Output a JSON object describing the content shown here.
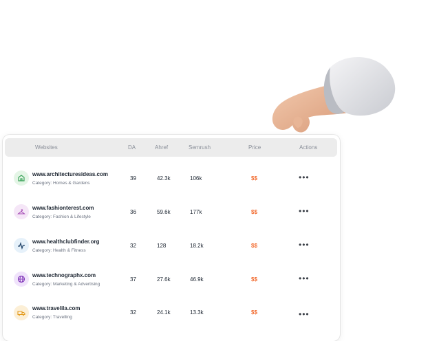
{
  "table": {
    "headers": {
      "websites": "Websites",
      "da": "DA",
      "ahref": "Ahref",
      "semrush": "Semrush",
      "price": "Price",
      "actions": "Actions"
    },
    "rows": [
      {
        "site": "www.architecturesideas.com",
        "category": "Category: Homes & Gardens",
        "da": "39",
        "ahref": "42.3k",
        "semrush": "106k",
        "price": "$$",
        "actions": "•••",
        "icon": "home-garden-icon",
        "icon_bg": "#e4f5e6",
        "icon_color": "#3aa35a"
      },
      {
        "site": "www.fashionterest.com",
        "category": "Category: Fashion & Lifestyle",
        "da": "36",
        "ahref": "59.6k",
        "semrush": "177k",
        "price": "$$",
        "actions": "•••",
        "icon": "hanger-icon",
        "icon_bg": "#f5e6f7",
        "icon_color": "#a34ab3"
      },
      {
        "site": "www.healthclubfinder.org",
        "category": "Category: Health & Fitness",
        "da": "32",
        "ahref": "128",
        "semrush": "18.2k",
        "price": "$$",
        "actions": "•••",
        "icon": "pulse-icon",
        "icon_bg": "#e6f1fa",
        "icon_color": "#23466b"
      },
      {
        "site": "www.technographx.com",
        "category": "Category: Marketing & Advertising",
        "da": "37",
        "ahref": "27.6k",
        "semrush": "46.9k",
        "price": "$$",
        "actions": "•••",
        "icon": "globe-icon",
        "icon_bg": "#f0e3fb",
        "icon_color": "#7b2fb5"
      },
      {
        "site": "www.travelila.com",
        "category": "Category: Travelling",
        "da": "32",
        "ahref": "24.1k",
        "semrush": "13.3k",
        "price": "$$",
        "actions": "•••",
        "icon": "truck-icon",
        "icon_bg": "#fcefd6",
        "icon_color": "#e39a1c"
      }
    ]
  },
  "colors": {
    "price": "#f26a2e",
    "header_bg": "#ececec"
  }
}
